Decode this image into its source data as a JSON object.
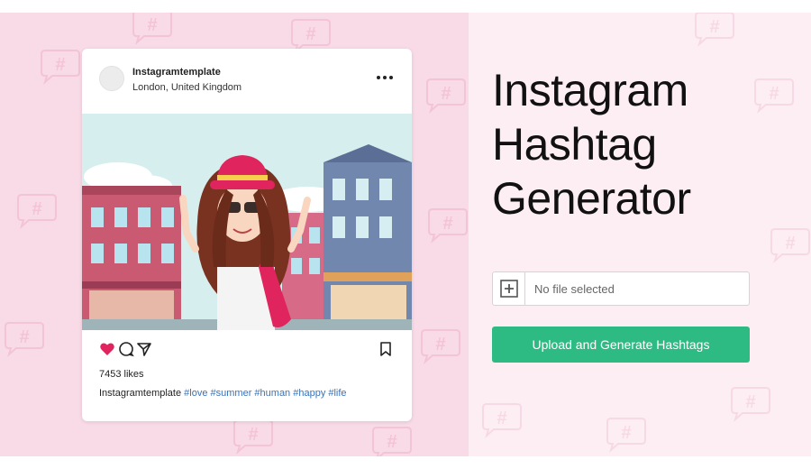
{
  "post": {
    "username": "Instagramtemplate",
    "location": "London, United Kingdom",
    "likes": "7453 likes",
    "caption_user": "Instagramtemplate",
    "caption_tags": "#love #summer #human #happy #life"
  },
  "headline": {
    "line1": "Instagram",
    "line2": "Hashtag",
    "line3": "Generator"
  },
  "upload": {
    "file_status": "No file selected",
    "button_label": "Upload and Generate Hashtags"
  },
  "colors": {
    "accent_green": "#2dbb83",
    "heart_red": "#e0245e",
    "left_bg": "#f9dbe8",
    "right_bg": "#fdeef4"
  },
  "icons": [
    "hashtag-bubble-icon",
    "more-options-icon",
    "heart-icon",
    "comment-icon",
    "share-icon",
    "bookmark-icon",
    "plus-icon"
  ]
}
